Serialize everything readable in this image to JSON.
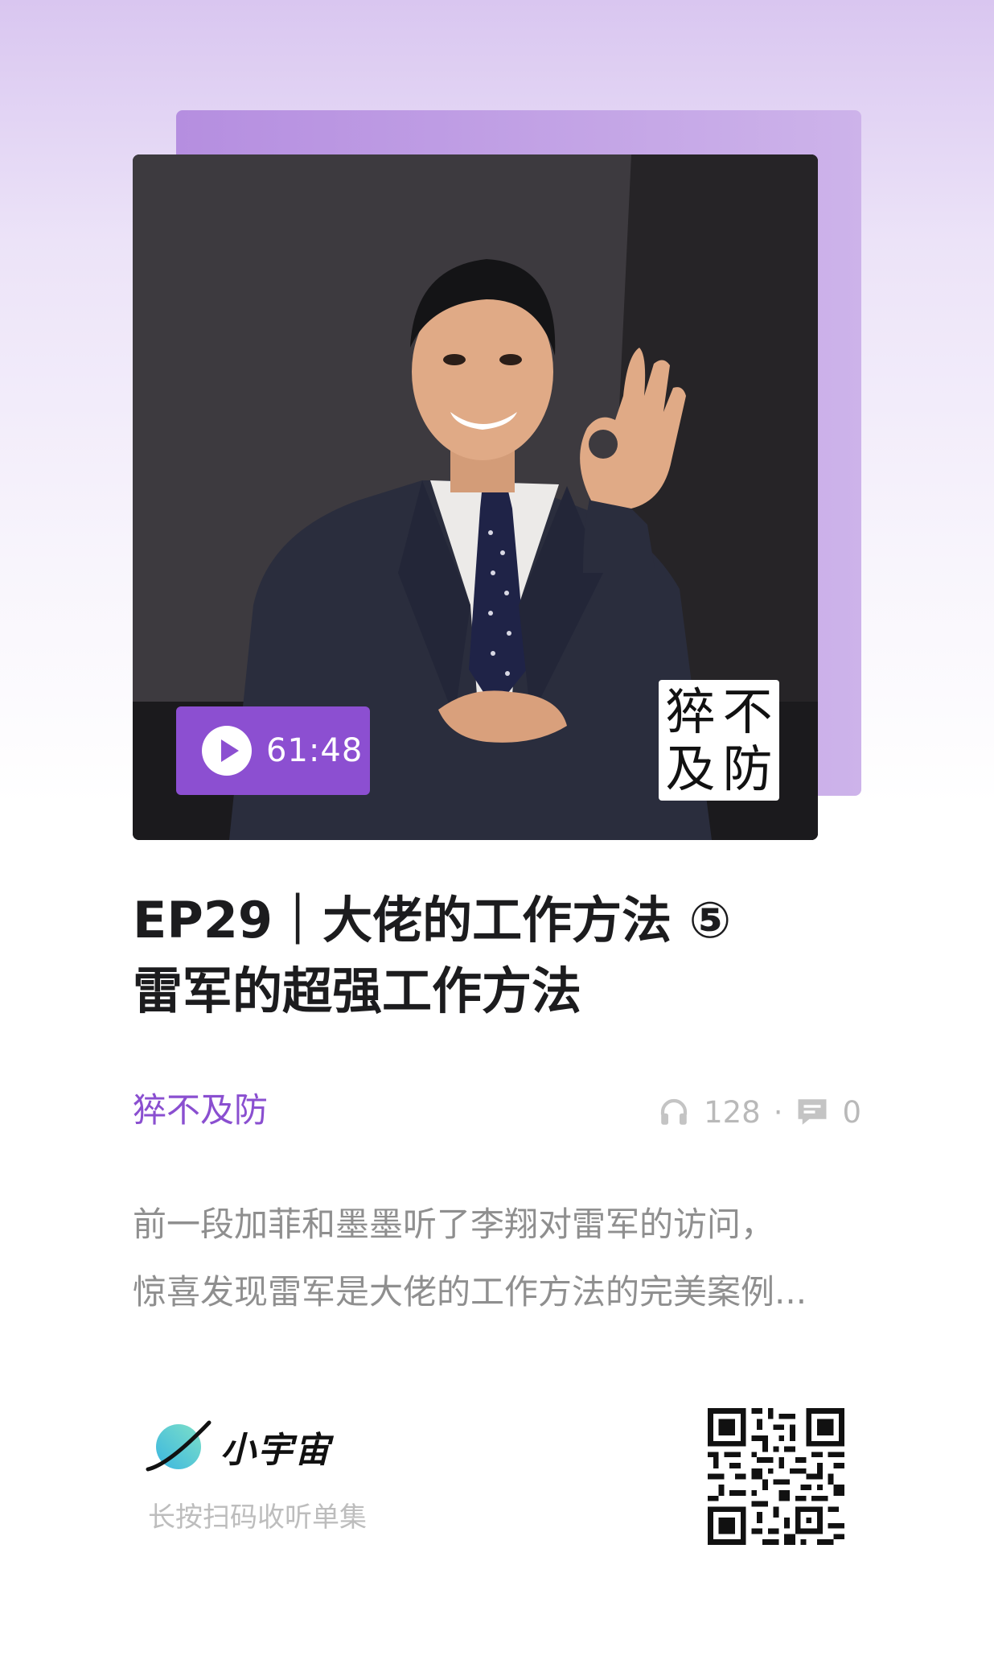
{
  "episode": {
    "duration": "61:48",
    "cover_stamp": [
      "猝",
      "不",
      "及",
      "防"
    ],
    "title_lines": [
      "EP29｜大佬的工作方法 ⑤",
      "雷军的超强工作方法"
    ],
    "podcast_name": "猝不及防",
    "listens": "128",
    "separator": "·",
    "comments": "0",
    "description_lines": [
      "前一段加菲和墨墨听了李翔对雷军的访问，",
      "惊喜发现雷军是大佬的工作方法的完美案例..."
    ]
  },
  "brand": {
    "name": "小宇宙",
    "scan_hint": "长按扫码收听单集"
  },
  "icons": {
    "listens": "headphones-icon",
    "comments": "comment-bubble-icon",
    "play": "play-icon",
    "logo": "planet-logo-icon",
    "qr": "qr-code"
  },
  "colors": {
    "accent": "#8c4fd1",
    "podcast_name": "#8a4fd0",
    "title": "#1c1c1e",
    "muted": "#b9b9b9",
    "description": "#8f8f8f"
  }
}
